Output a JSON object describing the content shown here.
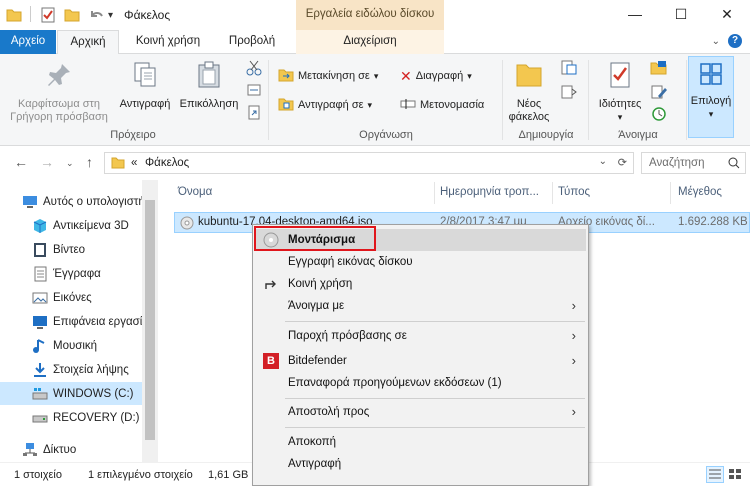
{
  "window": {
    "title": "Φάκελος",
    "context_tab_group": "Εργαλεία ειδώλου δίσκου",
    "controls": {
      "minimize": "—",
      "maximize": "☐",
      "close": "✕"
    }
  },
  "tabs": [
    {
      "label": "Αρχείο"
    },
    {
      "label": "Αρχική"
    },
    {
      "label": "Κοινή χρήση"
    },
    {
      "label": "Προβολή"
    },
    {
      "label": "Διαχείριση"
    }
  ],
  "ribbon": {
    "clipboard": {
      "pin": "Καρφίτσωμα στη Γρήγορη πρόσβαση",
      "copy": "Αντιγραφή",
      "paste": "Επικόλληση",
      "label": "Πρόχειρο"
    },
    "organize": {
      "move_to": "Μετακίνηση σε",
      "copy_to": "Αντιγραφή σε",
      "delete": "Διαγραφή",
      "rename": "Μετονομασία",
      "label": "Οργάνωση"
    },
    "new": {
      "new_folder": "Νέος φάκελος",
      "label": "Δημιουργία"
    },
    "open": {
      "properties": "Ιδιότητες",
      "label": "Άνοιγμα"
    },
    "select": {
      "select": "Επιλογή"
    }
  },
  "address": {
    "prefix": "«",
    "path": "Φάκελος",
    "search_placeholder": "Αναζήτηση"
  },
  "nav_pane": {
    "items": [
      {
        "label": "Αυτός ο υπολογιστής",
        "icon": "pc-icon"
      },
      {
        "label": "Αντικείμενα 3D",
        "icon": "objects-3d-icon"
      },
      {
        "label": "Βίντεο",
        "icon": "video-icon"
      },
      {
        "label": "Έγγραφα",
        "icon": "documents-icon"
      },
      {
        "label": "Εικόνες",
        "icon": "pictures-icon"
      },
      {
        "label": "Επιφάνεια εργασίας",
        "icon": "desktop-icon"
      },
      {
        "label": "Μουσική",
        "icon": "music-icon"
      },
      {
        "label": "Στοιχεία λήψης",
        "icon": "downloads-icon"
      },
      {
        "label": "WINDOWS (C:)",
        "icon": "windows-drive-icon"
      },
      {
        "label": "RECOVERY (D:)",
        "icon": "drive-icon"
      },
      {
        "label": "Δίκτυο",
        "icon": "network-icon"
      }
    ]
  },
  "columns": {
    "name": "Όνομα",
    "date": "Ημερομηνία τροπ...",
    "type": "Τύπος",
    "size": "Μέγεθος"
  },
  "files": [
    {
      "name": "kubuntu-17.04-desktop-amd64.iso",
      "date": "2/8/2017 3:47 μμ",
      "type": "Αρχείο εικόνας δί...",
      "size": "1.692.288 KB"
    }
  ],
  "status": {
    "count": "1 στοιχείο",
    "selected": "1 επιλεγμένο στοιχείο",
    "size": "1,61 GB"
  },
  "context_menu": {
    "items": [
      {
        "label": "Μοντάρισμα"
      },
      {
        "label": "Εγγραφή εικόνας δίσκου"
      },
      {
        "label": "Κοινή χρήση"
      },
      {
        "label": "Άνοιγμα με"
      },
      {
        "label": "Παροχή πρόσβασης σε"
      },
      {
        "label": "Bitdefender"
      },
      {
        "label": "Επαναφορά προηγούμενων εκδόσεων (1)"
      },
      {
        "label": "Αποστολή προς"
      },
      {
        "label": "Αποκοπή"
      },
      {
        "label": "Αντιγραφή"
      }
    ],
    "highlight_color": "#e0161c"
  },
  "colors": {
    "file_tab": "#1979ca",
    "context_tab": "#f8e4c6",
    "selection": "#cce8ff"
  }
}
